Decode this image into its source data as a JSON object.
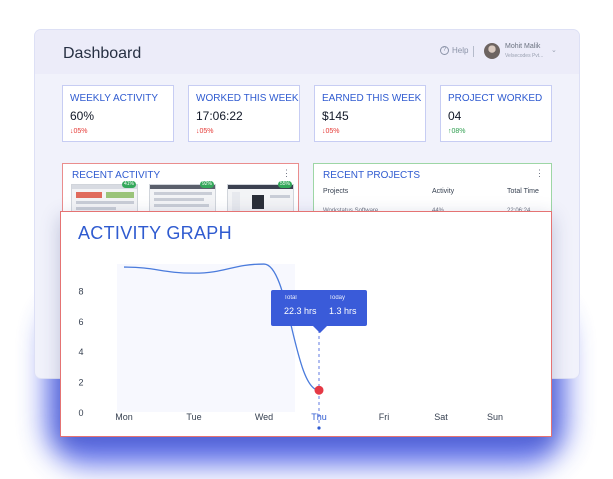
{
  "header": {
    "title": "Dashboard",
    "help_label": "Help",
    "help_glyph": "?",
    "user_name": "Mohit Malik",
    "user_org": "Velsecodes Pvt...",
    "chevron": "⌄"
  },
  "stats": [
    {
      "label": "WEEKLY ACTIVITY",
      "value": "60%",
      "delta": "↓05%",
      "trend": "down"
    },
    {
      "label": "WORKED THIS WEEK",
      "value": "17:06:22",
      "delta": "↓05%",
      "trend": "down"
    },
    {
      "label": "EARNED THIS WEEK",
      "value": "$145",
      "delta": "↓05%",
      "trend": "down"
    },
    {
      "label": "PROJECT WORKED",
      "value": "04",
      "delta": "↑08%",
      "trend": "up"
    }
  ],
  "recent_activity": {
    "title": "RECENT ACTIVITY",
    "badges": [
      "41%",
      "92%",
      "55%"
    ]
  },
  "recent_projects": {
    "title": "RECENT PROJECTS",
    "columns": [
      "Projects",
      "Activity",
      "Total Time"
    ],
    "row": [
      "Workstatus Software",
      "44%",
      "22:06:24"
    ]
  },
  "kebab_glyph": "⋮",
  "activity_graph": {
    "title": "ACTIVITY GRAPH",
    "tooltip": {
      "total_label": "Total",
      "total_value": "22.3 hrs",
      "today_label": "Today",
      "today_value": "1.3 hrs"
    }
  },
  "colors": {
    "accent": "#2f5bd0",
    "tooltip": "#3a5bd9",
    "line": "#4a7bdc",
    "marker": "#e53945",
    "glow": "#4256e8"
  },
  "chart_data": {
    "type": "line",
    "title": "ACTIVITY GRAPH",
    "categories": [
      "Mon",
      "Tue",
      "Wed",
      "Thu",
      "Fri",
      "Sat",
      "Sun"
    ],
    "y_ticks": [
      "0",
      "2",
      "4",
      "6",
      "8"
    ],
    "ylim": [
      0,
      10
    ],
    "series": [
      {
        "values": [
          9.6,
          9.2,
          9.8,
          1.5
        ]
      }
    ],
    "selected_category": "Thu",
    "grid": false
  }
}
